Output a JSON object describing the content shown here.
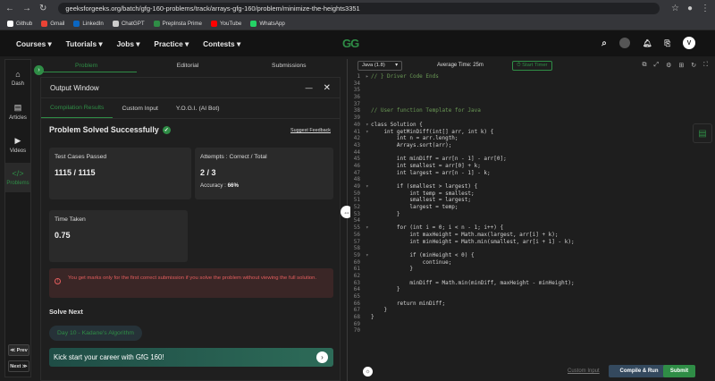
{
  "browser": {
    "url": "geeksforgeeks.org/batch/gfg-160-problems/track/arrays-gfg-160/problem/minimize-the-heights3351"
  },
  "bookmarks": [
    {
      "label": "Github",
      "color": "#ffffff"
    },
    {
      "label": "Gmail",
      "color": "#ea4335"
    },
    {
      "label": "LinkedIn",
      "color": "#0a66c2"
    },
    {
      "label": "ChatGPT",
      "color": "#cccccc"
    },
    {
      "label": "PrepInsta Prime",
      "color": "#2f8d46"
    },
    {
      "label": "YouTube",
      "color": "#ff0000"
    },
    {
      "label": "WhatsApp",
      "color": "#25d366"
    }
  ],
  "nav": {
    "menu": [
      "Courses ▾",
      "Tutorials ▾",
      "Jobs ▾",
      "Practice ▾",
      "Contests ▾"
    ],
    "logo": "GG",
    "avatar": "V"
  },
  "sidebar": {
    "items": [
      {
        "icon": "⌂",
        "label": "Dash"
      },
      {
        "icon": "▤",
        "label": "Articles"
      },
      {
        "icon": "▶",
        "label": "Videos"
      },
      {
        "icon": "</>",
        "label": "Problems"
      }
    ],
    "prev": "≪ Prev",
    "next": "Next ≫"
  },
  "left_tabs": [
    "Problem",
    "Editorial",
    "Submissions"
  ],
  "output": {
    "title": "Output Window",
    "tabs": [
      "Compilation Results",
      "Custom Input",
      "Y.O.G.I. (AI Bot)"
    ],
    "status": "Problem Solved Successfully",
    "feedback": "Suggest Feedback",
    "tests_label": "Test Cases Passed",
    "tests_value": "1115 / 1115",
    "attempts_label": "Attempts : Correct / Total",
    "attempts_value": "2 / 3",
    "accuracy_label": "Accuracy : ",
    "accuracy_value": "66%",
    "time_label": "Time Taken",
    "time_value": "0.75",
    "warning": "You get marks only for the first correct submission if you solve the problem without viewing the full solution.",
    "solve_next": "Solve Next",
    "next_chip": "Day 10 - Kadane's Algorithm",
    "banner": "Kick start your career with GfG 160!"
  },
  "editor": {
    "language": "Java (1.8)",
    "avg_time": "Average Time: 25m",
    "timer": "Start Timer",
    "custom_input": "Custom Input",
    "run": "Compile & Run",
    "submit": "Submit"
  },
  "code": [
    {
      "n": "1",
      "t": "// } Driver Code Ends",
      "cls": "cm",
      "fold": "▸"
    },
    {
      "n": "34",
      "t": ""
    },
    {
      "n": "35",
      "t": ""
    },
    {
      "n": "36",
      "t": ""
    },
    {
      "n": "37",
      "t": ""
    },
    {
      "n": "38",
      "t": "// User function Template for Java",
      "cls": "cm"
    },
    {
      "n": "39",
      "t": ""
    },
    {
      "n": "40",
      "t": "class Solution {",
      "fold": "▾"
    },
    {
      "n": "41",
      "t": "    int getMinDiff(int[] arr, int k) {",
      "fold": "▾"
    },
    {
      "n": "42",
      "t": "        int n = arr.length;"
    },
    {
      "n": "43",
      "t": "        Arrays.sort(arr);"
    },
    {
      "n": "44",
      "t": ""
    },
    {
      "n": "45",
      "t": "        int minDiff = arr[n - 1] - arr[0];"
    },
    {
      "n": "46",
      "t": "        int smallest = arr[0] + k;"
    },
    {
      "n": "47",
      "t": "        int largest = arr[n - 1] - k;"
    },
    {
      "n": "48",
      "t": ""
    },
    {
      "n": "49",
      "t": "        if (smallest > largest) {",
      "fold": "▾"
    },
    {
      "n": "50",
      "t": "            int temp = smallest;"
    },
    {
      "n": "51",
      "t": "            smallest = largest;"
    },
    {
      "n": "52",
      "t": "            largest = temp;"
    },
    {
      "n": "53",
      "t": "        }"
    },
    {
      "n": "54",
      "t": ""
    },
    {
      "n": "55",
      "t": "        for (int i = 0; i < n - 1; i++) {",
      "fold": "▾"
    },
    {
      "n": "56",
      "t": "            int maxHeight = Math.max(largest, arr[i] + k);"
    },
    {
      "n": "57",
      "t": "            int minHeight = Math.min(smallest, arr[i + 1] - k);"
    },
    {
      "n": "58",
      "t": ""
    },
    {
      "n": "59",
      "t": "            if (minHeight < 0) {",
      "fold": "▾"
    },
    {
      "n": "60",
      "t": "                continue;"
    },
    {
      "n": "61",
      "t": "            }"
    },
    {
      "n": "62",
      "t": ""
    },
    {
      "n": "63",
      "t": "            minDiff = Math.min(minDiff, maxHeight - minHeight);"
    },
    {
      "n": "64",
      "t": "        }"
    },
    {
      "n": "65",
      "t": ""
    },
    {
      "n": "66",
      "t": "        return minDiff;"
    },
    {
      "n": "67",
      "t": "    }"
    },
    {
      "n": "68",
      "t": "}"
    },
    {
      "n": "69",
      "t": ""
    },
    {
      "n": "70",
      "t": ""
    }
  ]
}
